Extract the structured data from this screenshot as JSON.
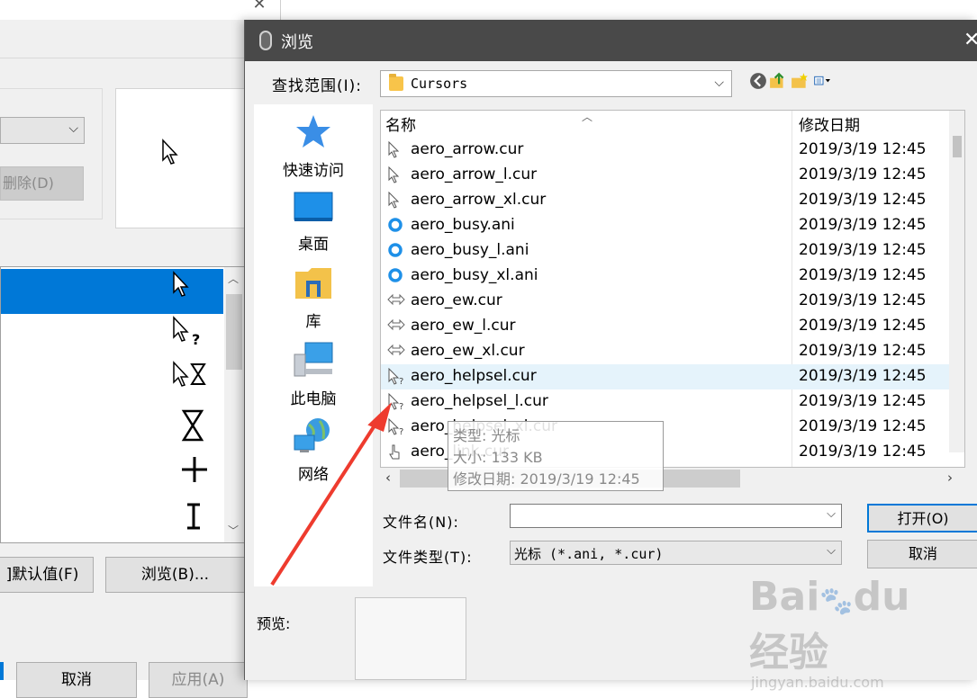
{
  "background_window": {
    "delete_button": "删除(D)",
    "use_default_button": "]默认值(F)",
    "browse_button": "浏览(B)...",
    "cancel_button": "取消",
    "apply_button": "应用(A)"
  },
  "dialog": {
    "title": "浏览",
    "look_in_label": "查找范围(I):",
    "look_in_value": "Cursors",
    "toolbar_icons": [
      "back-icon",
      "up-folder-icon",
      "new-folder-icon",
      "view-menu-icon"
    ],
    "places": [
      {
        "label": "快速访问",
        "icon": "star-icon"
      },
      {
        "label": "桌面",
        "icon": "desktop-icon"
      },
      {
        "label": "库",
        "icon": "library-icon"
      },
      {
        "label": "此电脑",
        "icon": "computer-icon"
      },
      {
        "label": "网络",
        "icon": "network-icon"
      }
    ],
    "columns": {
      "name": "名称",
      "date": "修改日期"
    },
    "files": [
      {
        "name": "aero_arrow.cur",
        "date": "2019/3/19 12:45",
        "icon": "arrow-cursor-icon"
      },
      {
        "name": "aero_arrow_l.cur",
        "date": "2019/3/19 12:45",
        "icon": "arrow-cursor-icon"
      },
      {
        "name": "aero_arrow_xl.cur",
        "date": "2019/3/19 12:45",
        "icon": "arrow-cursor-icon"
      },
      {
        "name": "aero_busy.ani",
        "date": "2019/3/19 12:45",
        "icon": "busy-ring-icon"
      },
      {
        "name": "aero_busy_l.ani",
        "date": "2019/3/19 12:45",
        "icon": "busy-ring-icon"
      },
      {
        "name": "aero_busy_xl.ani",
        "date": "2019/3/19 12:45",
        "icon": "busy-ring-icon"
      },
      {
        "name": "aero_ew.cur",
        "date": "2019/3/19 12:45",
        "icon": "resize-ew-icon"
      },
      {
        "name": "aero_ew_l.cur",
        "date": "2019/3/19 12:45",
        "icon": "resize-ew-icon"
      },
      {
        "name": "aero_ew_xl.cur",
        "date": "2019/3/19 12:45",
        "icon": "resize-ew-icon"
      },
      {
        "name": "aero_helpsel.cur",
        "date": "2019/3/19 12:45",
        "icon": "help-cursor-icon"
      },
      {
        "name": "aero_helpsel_l.cur",
        "date": "2019/3/19 12:45",
        "icon": "help-cursor-icon"
      },
      {
        "name": "aero_helpsel_xl.cur",
        "date": "2019/3/19 12:45",
        "icon": "help-cursor-icon"
      },
      {
        "name": "aero_link.cur",
        "date": "2019/3/19 12:45",
        "icon": "hand-cursor-icon"
      }
    ],
    "tooltip": {
      "type": "类型: 光标",
      "size": "大小: 133 KB",
      "modified": "修改日期: 2019/3/19 12:45"
    },
    "filename_label": "文件名(N):",
    "filename_value": "",
    "filetype_label": "文件类型(T):",
    "filetype_value": "光标 (*.ani, *.cur)",
    "open_button": "打开(O)",
    "cancel_button": "取消",
    "preview_label": "预览:"
  },
  "watermark": {
    "logo": "Baidu经验",
    "url": "jingyan.baidu.com"
  },
  "colors": {
    "accent": "#0078d7",
    "title_bar": "#494949",
    "annotation_arrow": "#ee3b2e"
  }
}
